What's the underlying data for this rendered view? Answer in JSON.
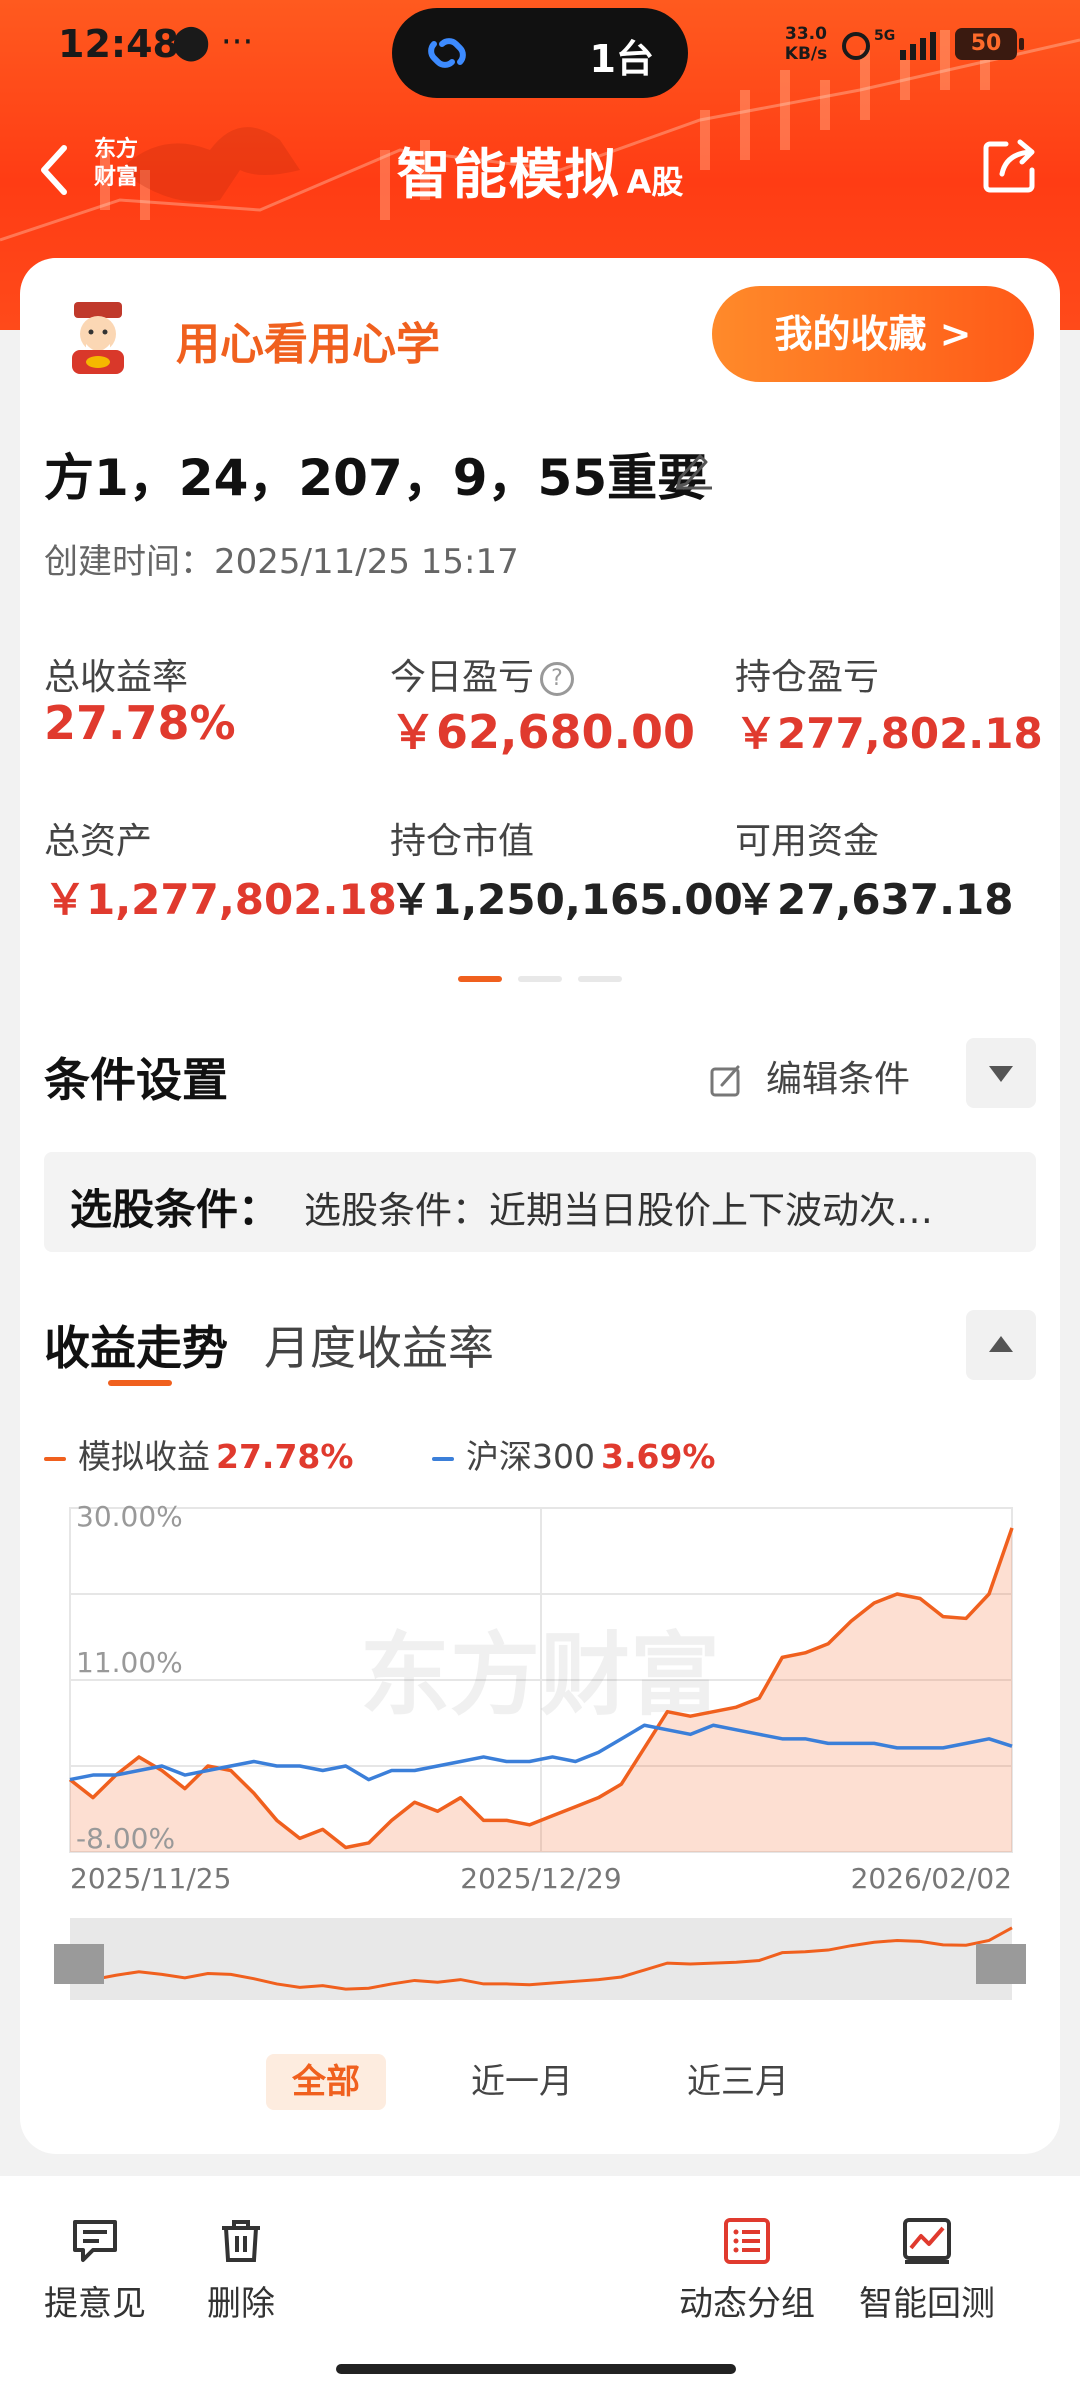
{
  "status_bar": {
    "time": "12:48",
    "extra": "⬤ ···",
    "island_count": "1台",
    "net_speed": "33.0\nKB/s",
    "battery": "50"
  },
  "nav": {
    "brand": "东方\n财富",
    "title": "智能模拟",
    "title_suffix": "A股"
  },
  "promo": {
    "text": "用心看用心学",
    "favorites_button": "我的收藏 >"
  },
  "strategy": {
    "name": "方1，24，207，9，55重要",
    "created": "创建时间：2025/11/25 15:17"
  },
  "metrics": [
    {
      "label": "总收益率",
      "value": "27.78%",
      "color": "#e03a2e"
    },
    {
      "label": "今日盈亏",
      "value": "￥62,680.00",
      "color": "#e03a2e"
    },
    {
      "label": "持仓盈亏",
      "value": "￥277,802.18",
      "color": "#e03a2e"
    },
    {
      "label": "总资产",
      "value": "￥1,277,802.18",
      "color": "#e03a2e"
    },
    {
      "label": "持仓市值",
      "value": "￥1,250,165.00",
      "color": "#222222"
    },
    {
      "label": "可用资金",
      "value": "￥27,637.18",
      "color": "#222222"
    }
  ],
  "help_glyph": "?",
  "conditions": {
    "title": "条件设置",
    "edit_label": "编辑条件",
    "box_label": "选股条件：",
    "box_text": "选股条件：近期当日股价上下波动次…"
  },
  "trend_tabs": {
    "main": "收益走势",
    "secondary": "月度收益率"
  },
  "legend": {
    "sim_label": "模拟收益",
    "sim_pct": "27.78%",
    "index_label": "沪深300",
    "index_pct": "3.69%"
  },
  "chart_data": {
    "type": "line",
    "y_ticks": [
      "30.00%",
      "11.00%",
      "-8.00%"
    ],
    "x_ticks": [
      "2025/11/25",
      "2025/12/29",
      "2026/02/02"
    ],
    "ylim": [
      -8,
      30
    ],
    "watermark": "东方财富",
    "series": [
      {
        "name": "模拟收益",
        "color": "#f0601e",
        "values": [
          0.0,
          -2.0,
          0.5,
          2.5,
          1.0,
          -1.0,
          1.5,
          1.0,
          -1.5,
          -4.5,
          -6.5,
          -5.5,
          -7.5,
          -7.0,
          -4.5,
          -2.5,
          -3.5,
          -2.0,
          -4.5,
          -4.5,
          -5.0,
          -4.0,
          -3.0,
          -2.0,
          -0.5,
          3.5,
          7.5,
          7.0,
          7.5,
          8.0,
          9.0,
          13.5,
          14.0,
          15.0,
          17.5,
          19.5,
          20.5,
          20.0,
          18.0,
          17.8,
          20.5,
          27.8
        ]
      },
      {
        "name": "沪深300",
        "color": "#3b7fd9",
        "values": [
          0.0,
          0.5,
          0.5,
          1.0,
          1.5,
          0.5,
          1.0,
          1.5,
          2.0,
          1.5,
          1.5,
          1.0,
          1.5,
          0.0,
          1.0,
          1.0,
          1.5,
          2.0,
          2.5,
          2.0,
          2.0,
          2.5,
          2.0,
          3.0,
          4.5,
          6.0,
          5.5,
          5.0,
          6.0,
          5.5,
          5.0,
          4.5,
          4.5,
          4.0,
          4.0,
          4.0,
          3.5,
          3.5,
          3.5,
          4.0,
          4.5,
          3.69
        ]
      }
    ]
  },
  "range_buttons": [
    "全部",
    "近一月",
    "近三月"
  ],
  "bottom_bar": [
    {
      "label": "提意见",
      "icon": "feedback-icon"
    },
    {
      "label": "删除",
      "icon": "trash-icon"
    },
    {
      "label": "动态分组",
      "icon": "list-icon"
    },
    {
      "label": "智能回测",
      "icon": "backtest-icon"
    }
  ]
}
